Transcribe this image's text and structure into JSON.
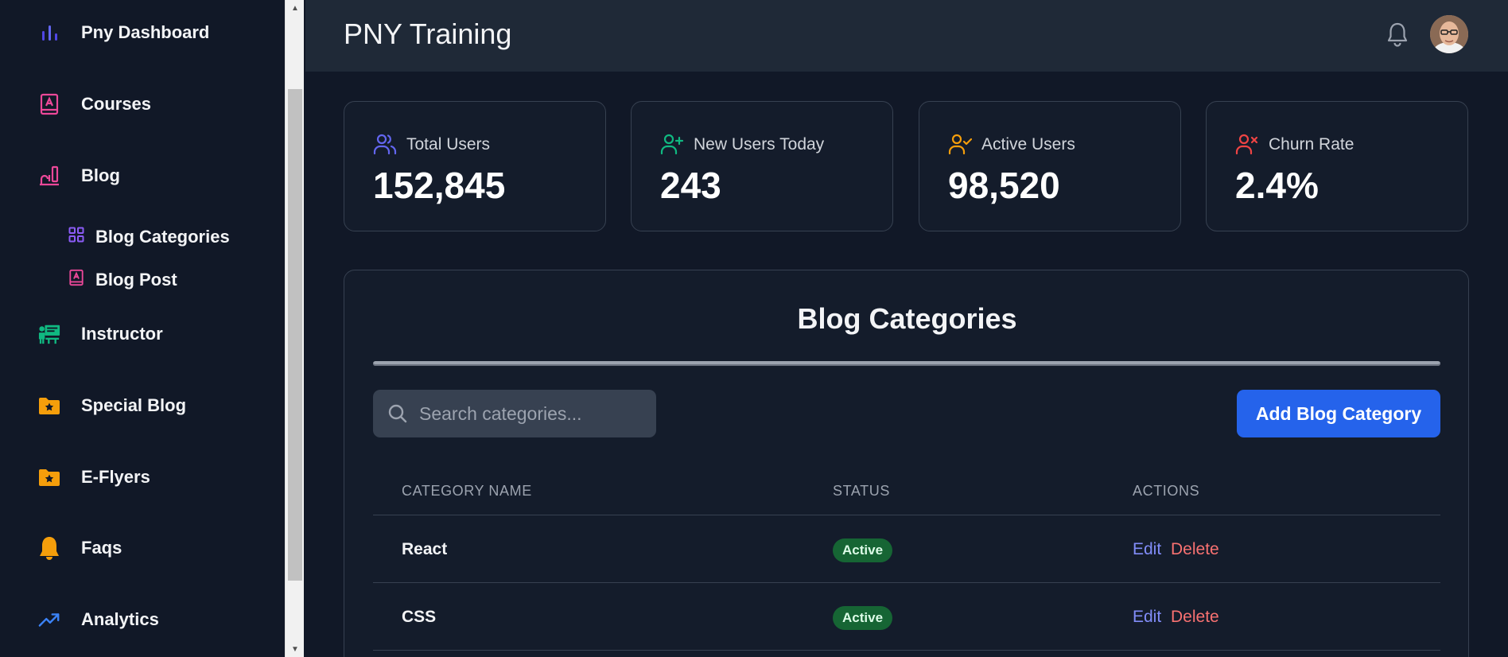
{
  "sidebar": {
    "items": [
      {
        "label": "Pny Dashboard",
        "icon": "bar-chart-icon"
      },
      {
        "label": "Courses",
        "icon": "book-icon"
      },
      {
        "label": "Blog",
        "icon": "blog-icon"
      },
      {
        "label": "Instructor",
        "icon": "instructor-icon"
      },
      {
        "label": "Special Blog",
        "icon": "star-folder-icon"
      },
      {
        "label": "E-Flyers",
        "icon": "star-folder-icon"
      },
      {
        "label": "Faqs",
        "icon": "faq-bell-icon"
      },
      {
        "label": "Analytics",
        "icon": "trending-up-icon"
      }
    ],
    "blog_subitems": [
      {
        "label": "Blog Categories",
        "icon": "grid-icon"
      },
      {
        "label": "Blog Post",
        "icon": "book-icon"
      }
    ]
  },
  "header": {
    "title": "PNY Training"
  },
  "stats": [
    {
      "label": "Total Users",
      "value": "152,845",
      "icon": "users-icon",
      "color": "#6366f1"
    },
    {
      "label": "New Users Today",
      "value": "243",
      "icon": "user-plus-icon",
      "color": "#10b981"
    },
    {
      "label": "Active Users",
      "value": "98,520",
      "icon": "user-check-icon",
      "color": "#f59e0b"
    },
    {
      "label": "Churn Rate",
      "value": "2.4%",
      "icon": "user-x-icon",
      "color": "#ef4444"
    }
  ],
  "panel": {
    "title": "Blog Categories",
    "search_placeholder": "Search categories...",
    "add_button": "Add Blog Category",
    "columns": [
      "CATEGORY NAME",
      "STATUS",
      "ACTIONS"
    ],
    "rows": [
      {
        "name": "React",
        "status": "Active",
        "edit": "Edit",
        "delete": "Delete"
      },
      {
        "name": "CSS",
        "status": "Active",
        "edit": "Edit",
        "delete": "Delete"
      }
    ]
  },
  "colors": {
    "background": "#111827",
    "header": "#1f2937",
    "primary": "#2563eb",
    "active_badge": "#166534",
    "edit": "#818cf8",
    "delete": "#f87171"
  }
}
